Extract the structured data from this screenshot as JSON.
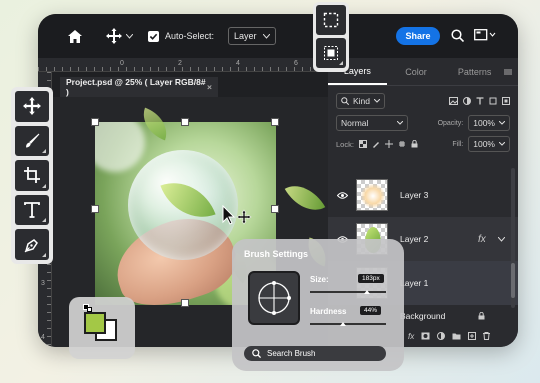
{
  "toolbar_top": {
    "auto_select_label": "Auto-Select:",
    "layer_select_value": "Layer",
    "share_label": "Share"
  },
  "ruler": {
    "top_ticks": [
      "0",
      "2",
      "4",
      "6"
    ],
    "left_ticks": [
      "1",
      "2",
      "3",
      "4"
    ]
  },
  "document": {
    "tab_title": "Project.psd @ 25% ( Layer RGB/8# )",
    "close_glyph": "×"
  },
  "layers_panel": {
    "tabs": [
      "Layers",
      "Color",
      "Patterns"
    ],
    "kind_label": "Kind",
    "blend_mode": "Normal",
    "opacity_label": "Opacity:",
    "opacity_value": "100%",
    "lock_label": "Lock:",
    "fill_label": "Fill:",
    "fill_value": "100%",
    "layers": [
      {
        "name": "Layer 3"
      },
      {
        "name": "Layer 2",
        "fx": "fx"
      },
      {
        "name": "Layer 1"
      },
      {
        "name": "Background"
      }
    ]
  },
  "brush_settings": {
    "title": "Brush Settings",
    "size_label": "Size:",
    "size_value": "183px",
    "size_level": 0.75,
    "hardness_label": "Hardness",
    "hardness_value": "44%",
    "hardness_level": 0.44,
    "search_label": "Search Brush"
  },
  "colors": {
    "accent": "#1473e6",
    "foreground_swatch": "#a3c846",
    "background_swatch": "#ffffff"
  },
  "icons": [
    "home-icon",
    "move-icon",
    "checkbox-icon",
    "search-icon",
    "screen-mode-icon",
    "marquee-icon",
    "object-select-icon",
    "move-tool-icon",
    "brush-tool-icon",
    "crop-tool-icon",
    "type-tool-icon",
    "pen-tool-icon",
    "eye-icon",
    "lock-icon"
  ]
}
